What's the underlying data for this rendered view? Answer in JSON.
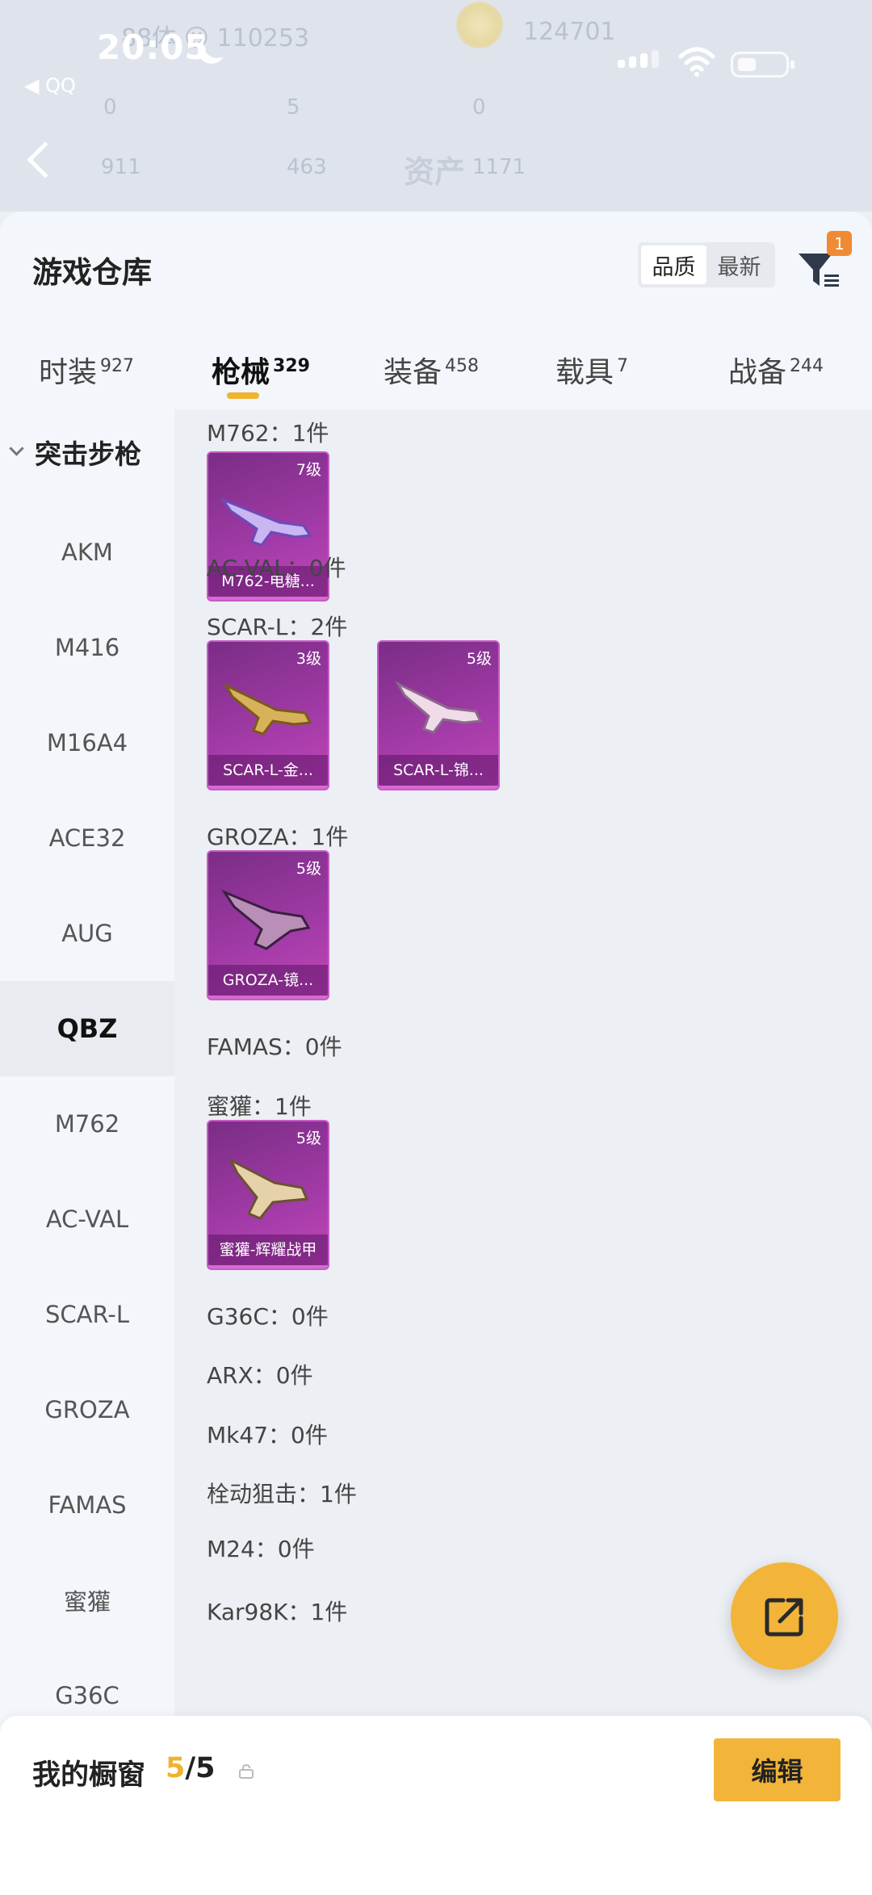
{
  "status_bar": {
    "time": "20:05",
    "back_app": "◀ QQ"
  },
  "background_header": {
    "faint_left": "88体  ☺ 110253",
    "faint_right": "124701",
    "faint_row2": [
      "0",
      "5",
      "0"
    ],
    "faint_row3": [
      "911",
      "463",
      "1171"
    ],
    "asset_title": "资产"
  },
  "panel": {
    "title": "游戏仓库",
    "sort_options": [
      "品质",
      "最新"
    ],
    "active_sort": "品质",
    "filter_badge": "1"
  },
  "tabs": [
    {
      "label": "时装",
      "count": "927"
    },
    {
      "label": "枪械",
      "count": "329"
    },
    {
      "label": "装备",
      "count": "458"
    },
    {
      "label": "载具",
      "count": "7"
    },
    {
      "label": "战备",
      "count": "244"
    }
  ],
  "sidebar": {
    "group": "突击步枪",
    "items": [
      "AKM",
      "M416",
      "M16A4",
      "ACE32",
      "AUG",
      "QBZ",
      "M762",
      "AC-VAL",
      "SCAR-L",
      "GROZA",
      "FAMAS",
      "蜜獾",
      "G36C"
    ],
    "active": "QBZ"
  },
  "rows": {
    "m762": "M762：1件",
    "acval": "AC-VAL：0件",
    "scarl": "SCAR-L：2件",
    "groza": "GROZA：1件",
    "famas": "FAMAS：0件",
    "mihuan": "蜜獾：1件",
    "g36c": "G36C：0件",
    "arx": "ARX：0件",
    "mk47": "Mk47：0件",
    "bolt": "栓动狙击：1件",
    "m24": "M24：0件",
    "kar98k": "Kar98K：1件"
  },
  "cards": [
    {
      "level": "7级",
      "name": "M762-电糖..."
    },
    {
      "level": "3级",
      "name": "SCAR-L-金..."
    },
    {
      "level": "5级",
      "name": "SCAR-L-锦..."
    },
    {
      "level": "5级",
      "name": "GROZA-镜..."
    },
    {
      "level": "5级",
      "name": "蜜獾-辉耀战甲"
    }
  ],
  "bottom": {
    "label": "我的橱窗",
    "current": "5",
    "total": "/5",
    "edit_label": "编辑"
  },
  "colors": {
    "accent": "#f3b43a",
    "card_purple": "#a33ba8",
    "badge_orange": "#f08a34"
  }
}
